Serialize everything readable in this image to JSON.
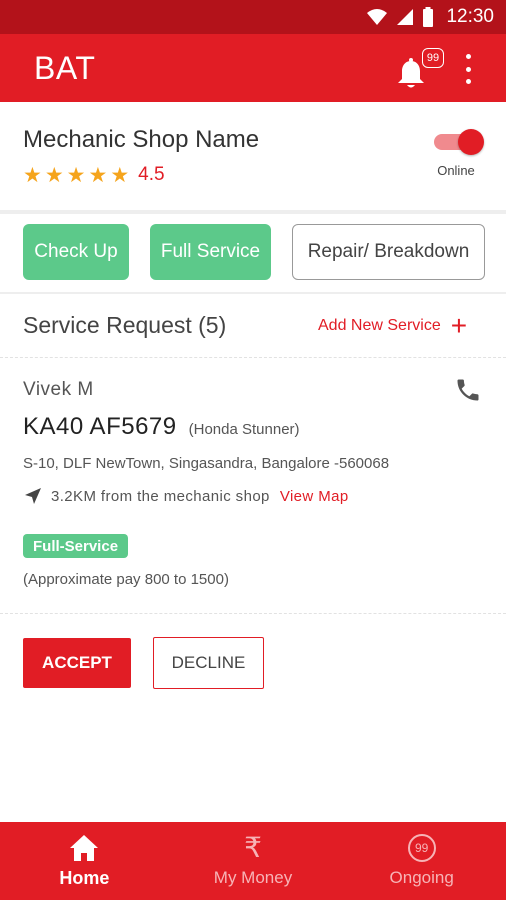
{
  "status_bar": {
    "time": "12:30"
  },
  "app_bar": {
    "title": "BAT",
    "notification_count": "99"
  },
  "shop": {
    "name": "Mechanic Shop Name",
    "rating": "4.5",
    "stars": 5,
    "online_label": "Online",
    "online": true
  },
  "service_types": [
    {
      "label": "Check Up",
      "selected": true
    },
    {
      "label": "Full Service",
      "selected": true
    },
    {
      "label": "Repair/ Breakdown",
      "selected": false
    }
  ],
  "requests": {
    "title": "Service Request (5)",
    "add_label": "Add New Service"
  },
  "request": {
    "customer": "Vivek M",
    "plate": "KA40 AF5679",
    "model": "(Honda Stunner)",
    "address": "S-10, DLF NewTown, Singasandra, Bangalore -560068",
    "distance": "3.2KM from the mechanic shop",
    "view_map": "View Map",
    "service_badge": "Full-Service",
    "approx_pay": "(Approximate pay 800 to 1500)",
    "accept": "ACCEPT",
    "decline": "DECLINE"
  },
  "bottom_nav": [
    {
      "label": "Home",
      "icon": "home-icon",
      "active": true
    },
    {
      "label": "My Money",
      "icon": "rupee-icon",
      "active": false
    },
    {
      "label": "Ongoing",
      "icon": "ongoing-99-icon",
      "badge": "99",
      "active": false
    }
  ],
  "colors": {
    "brand_red": "#e11d25",
    "status_bar": "#b3121a",
    "green": "#5cc98a",
    "star": "#f5a41c"
  }
}
